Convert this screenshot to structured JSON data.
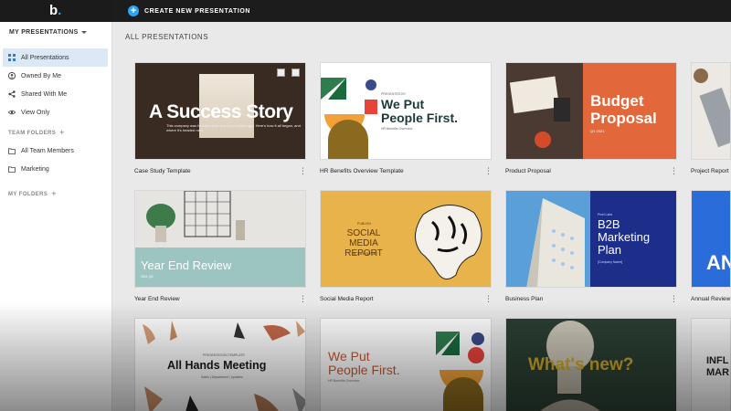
{
  "app": {
    "logo_letter": "b",
    "logo_dot": "."
  },
  "toolbar": {
    "create_label": "CREATE NEW PRESENTATION"
  },
  "sidebar": {
    "header": "MY PRESENTATIONS",
    "items": [
      {
        "label": "All Presentations",
        "icon": "grid-icon",
        "active": true
      },
      {
        "label": "Owned By Me",
        "icon": "user-icon"
      },
      {
        "label": "Shared With Me",
        "icon": "share-icon"
      },
      {
        "label": "View Only",
        "icon": "eye-icon"
      }
    ],
    "team_folders_header": "TEAM FOLDERS",
    "team_folders": [
      {
        "label": "All Team Members",
        "icon": "folder-icon"
      },
      {
        "label": "Marketing",
        "icon": "folder-icon"
      }
    ],
    "my_folders_header": "MY FOLDERS"
  },
  "main": {
    "title": "ALL PRESENTATIONS",
    "cards": [
      {
        "label": "Case Study Template",
        "thumb": {
          "title": "A Success Story",
          "sub": "This company was founded over a hundred years ago. Here's how it all began, and where it's headed next."
        }
      },
      {
        "label": "HR Benefits Overview Template",
        "thumb": {
          "title_l1": "We Put",
          "title_l2": "People First.",
          "top": "PRESENTED BY",
          "bottom": "HR Benefits Overview"
        }
      },
      {
        "label": "Product Proposal",
        "thumb": {
          "title_l1": "Budget",
          "title_l2": "Proposal",
          "date": "Q1 2021"
        }
      },
      {
        "label": "Project Report"
      },
      {
        "label": "Year End Review",
        "thumb": {
          "title": "Year End Review",
          "sub": "2021 Q3"
        }
      },
      {
        "label": "Social Media Report",
        "thumb": {
          "top": "PUBLISH",
          "title_l1": "SOCIAL MEDIA",
          "title_l2": "REPORT",
          "bottom": "Q1 2021 REPORT"
        }
      },
      {
        "label": "Business Plan",
        "thumb": {
          "top": "Pixel Labs",
          "title_l1": "B2B",
          "title_l2": "Marketing",
          "title_l3": "Plan",
          "bottom": "[Company Name]"
        }
      },
      {
        "label": "Annual Review",
        "thumb": {
          "letters": "AN"
        }
      },
      {
        "label": "",
        "thumb": {
          "top": "PRESENTATION TEMPLATE",
          "title": "All Hands Meeting",
          "bottom": "Sales | Department | Updates"
        }
      },
      {
        "label": "",
        "thumb": {
          "title_l1": "We Put",
          "title_l2": "People First.",
          "bottom": "HR Benefits Overview"
        }
      },
      {
        "label": "",
        "thumb": {
          "title": "What's new?"
        }
      },
      {
        "label": "",
        "thumb": {
          "l1": "INFL",
          "l2": "MAR"
        }
      }
    ]
  },
  "colors": {
    "accent": "#2ea3f2",
    "topbar": "#1c1c1c",
    "active_nav": "#dbe9f6",
    "budget_orange": "#e2673a",
    "social_yellow": "#e9b34b",
    "b2b_navy": "#1d2d8a",
    "yearend_teal": "#9cc4c0"
  }
}
